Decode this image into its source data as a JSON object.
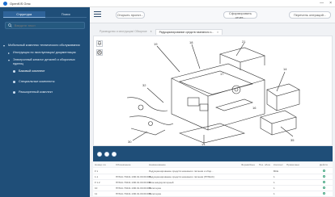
{
  "window": {
    "title": "OpenKIS Gmc",
    "controls": [
      "—",
      "×"
    ]
  },
  "sidebar": {
    "tabs": [
      "Структура",
      "Поиск"
    ],
    "active_tab": 0,
    "search_placeholder": "Введите текст",
    "tree": [
      {
        "label": "Мобильный комплекс технического обслуживания",
        "level": 1,
        "expanded": true
      },
      {
        "label": "Инструкция по эксплуатации/ документация",
        "level": 2,
        "expanded": false
      },
      {
        "label": "Электронный каталог деталей и сборочных единиц",
        "level": 2,
        "expanded": true
      },
      {
        "label": "Базовый комплект",
        "level": 3,
        "selected": true
      },
      {
        "label": "Специальные комплекты",
        "level": 3
      },
      {
        "label": "Расширенный комплект",
        "level": 3
      }
    ]
  },
  "toolbar": {
    "open_project": "Открыть проект...",
    "make_report": "Сформировать отчет...",
    "operations": "Перечень операций..."
  },
  "doc_tabs": [
    {
      "label": "Руководство и инструкция/ Обзорное",
      "active": false
    },
    {
      "label": "Редукционирование средств наземного з...",
      "active": true
    }
  ],
  "table": {
    "headers": [
      "Номер позиции",
      "Обозначение",
      "Наименование",
      "Формат",
      "Зона",
      "Поз. обозначение",
      "Количество",
      "Примечание",
      "Действия"
    ],
    "rows": [
      {
        "num": "▾ 1",
        "code": "",
        "name": "Редукционирование средств наземного питания и обор...",
        "fmt": "",
        "zone": "",
        "pos": "",
        "qty": "ВСЕ",
        "note": ""
      },
      {
        "num": "1.1",
        "code": "ПУМ-К.70241.1/00.01.00.00.000",
        "name": "Редукционирование средств наземного питания (ПУМНС)",
        "fmt": "",
        "zone": "",
        "pos": "",
        "qty": "1",
        "note": ""
      },
      {
        "num": "▾ 1.2",
        "code": "ПУМ-К.70241.1/00.01.00.00.000",
        "name": "Блок аккумуляторный",
        "fmt": "",
        "zone": "",
        "pos": "",
        "qty": "1",
        "note": ""
      },
      {
        "num": "10",
        "code": "ПУМ-К.70241.1/00.01.00.00.000",
        "name": "Полотерка",
        "fmt": "",
        "zone": "",
        "pos": "",
        "qty": "1",
        "note": ""
      },
      {
        "num": "11",
        "code": "ПУМ-К.70241.1/00.01.00.00.000",
        "name": "Полотерка",
        "fmt": "",
        "zone": "",
        "pos": "",
        "qty": "1",
        "note": ""
      }
    ]
  },
  "drawing_callouts": [
    "1",
    "2",
    "3",
    "4",
    "5",
    "6",
    "7",
    "8",
    "9",
    "10",
    "11",
    "12",
    "13",
    "14",
    "15",
    "16",
    "17",
    "18",
    "19",
    "20"
  ],
  "colors": {
    "sidebar": "#1f4e78",
    "accent": "#2e6399",
    "status_ok": "#3aa07a",
    "desktop": "#4f8a3e"
  }
}
